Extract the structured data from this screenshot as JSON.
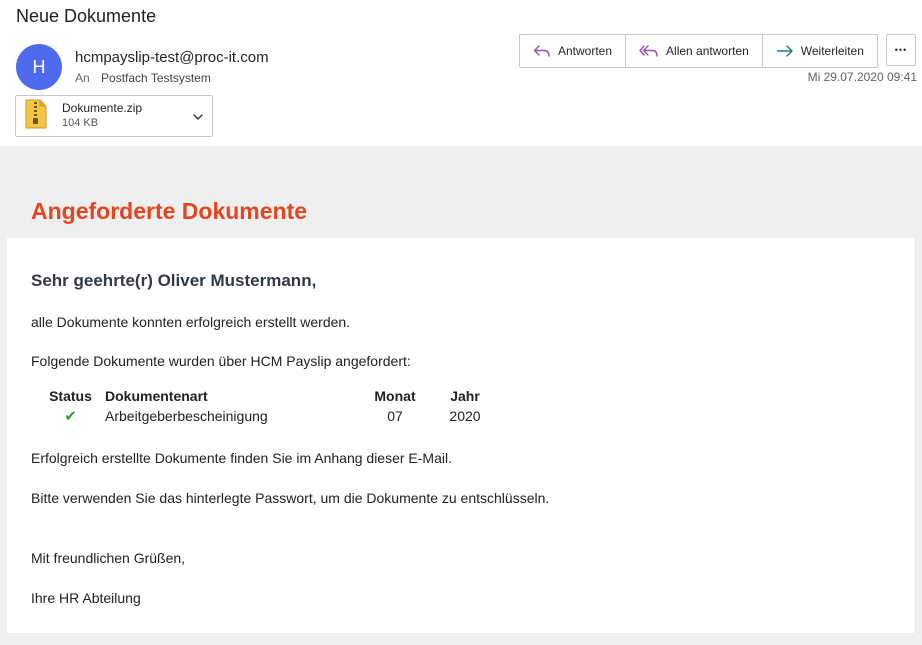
{
  "email": {
    "subject": "Neue Dokumente",
    "avatar_initial": "H",
    "sender": "hcmpayslip-test@proc-it.com",
    "to_label": "An",
    "to_value": "Postfach Testsystem",
    "date": "Mi 29.07.2020 09:41"
  },
  "actions": {
    "reply": "Antworten",
    "reply_all": "Allen antworten",
    "forward": "Weiterleiten",
    "more": "•••"
  },
  "attachment": {
    "name": "Dokumente.zip",
    "size": "104 KB"
  },
  "body": {
    "banner_title": "Angeforderte Dokumente",
    "greeting": "Sehr geehrte(r) Oliver Mustermann,",
    "line1": "alle Dokumente konnten erfolgreich erstellt werden.",
    "line2": "Folgende Dokumente wurden über HCM Payslip angefordert:",
    "table": {
      "headers": [
        "Status",
        "Dokumentenart",
        "Monat",
        "Jahr"
      ],
      "rows": [
        {
          "status": "✔",
          "art": "Arbeitgeberbescheinigung",
          "monat": "07",
          "jahr": "2020"
        }
      ]
    },
    "line3": "Erfolgreich erstellte Dokumente finden Sie im Anhang dieser E-Mail.",
    "line4": "Bitte verwenden Sie das hinterlegte Passwort, um die Dokumente zu entschlüsseln.",
    "closing": "Mit freundlichen Grüßen,",
    "signature": "Ihre HR Abteilung"
  },
  "colors": {
    "accent_orange": "#e5461f",
    "avatar_blue": "#4f6bed",
    "check_green": "#2e9e2e",
    "reply_purple": "#9b4fb0",
    "forward_teal": "#1f7a8c"
  }
}
